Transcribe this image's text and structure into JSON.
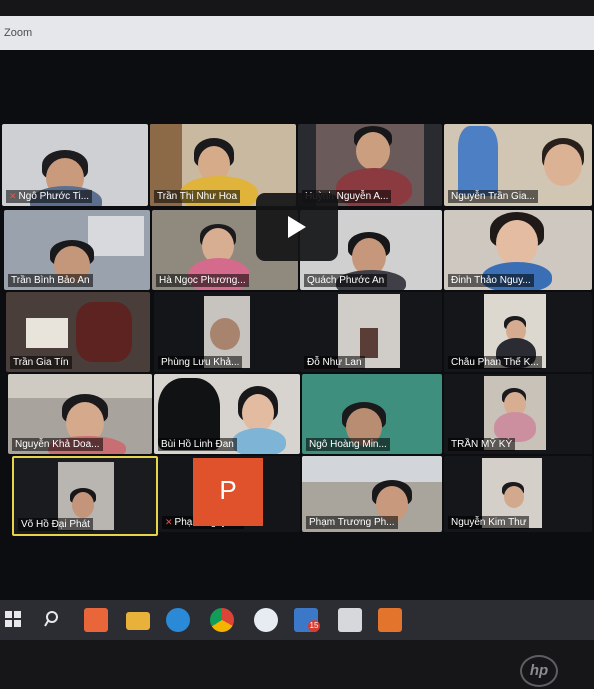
{
  "window": {
    "title": "Zoom"
  },
  "participants": [
    {
      "name": "Ngô Phước Ti...",
      "muted": true
    },
    {
      "name": "Trần Thị Như Hoa",
      "muted": false
    },
    {
      "name": "Huỳnh Nguyễn A...",
      "muted": false
    },
    {
      "name": "Nguyễn Trần Gia...",
      "muted": false
    },
    {
      "name": "Trần Bình Bảo An",
      "muted": false
    },
    {
      "name": "Hà Ngọc Phương...",
      "muted": false
    },
    {
      "name": "Quách Phước An",
      "muted": false
    },
    {
      "name": "Đinh Thảo Nguy...",
      "muted": false
    },
    {
      "name": "Trần Gia Tín",
      "muted": false
    },
    {
      "name": "Phùng Lưu Khả...",
      "muted": false
    },
    {
      "name": "Đỗ Như Lan",
      "muted": false
    },
    {
      "name": "Châu Phan Thế K...",
      "muted": false
    },
    {
      "name": "Nguyễn Khả Doa...",
      "muted": false
    },
    {
      "name": "Bùi Hồ Linh Đan",
      "muted": false
    },
    {
      "name": "Ngô Hoàng Min...",
      "muted": false
    },
    {
      "name": "TRẦN MỸ KỲ",
      "muted": false
    },
    {
      "name": "Võ Hồ Đại Phát",
      "muted": false,
      "active_speaker": true
    },
    {
      "name": "Phạm Nguyễ...",
      "muted": true,
      "avatar_letter": "P"
    },
    {
      "name": "Phạm Trương Ph...",
      "muted": false
    },
    {
      "name": "Nguyễn Kim Thư",
      "muted": false
    }
  ],
  "video_overlay": {
    "icon": "play-icon"
  },
  "taskbar": {
    "icons": [
      "windows-start-icon",
      "search-icon",
      "office-icon",
      "file-explorer-icon",
      "edge-icon",
      "chrome-icon",
      "zoom-icon",
      "mail-icon",
      "remote-icon",
      "teams-icon"
    ],
    "mail_badge": "15"
  },
  "monitor": {
    "brand": "hp"
  },
  "colors": {
    "active_speaker_border": "#e8d34a",
    "muted_mic": "#ff4a4a",
    "avatar_bg": "#e0522c"
  }
}
